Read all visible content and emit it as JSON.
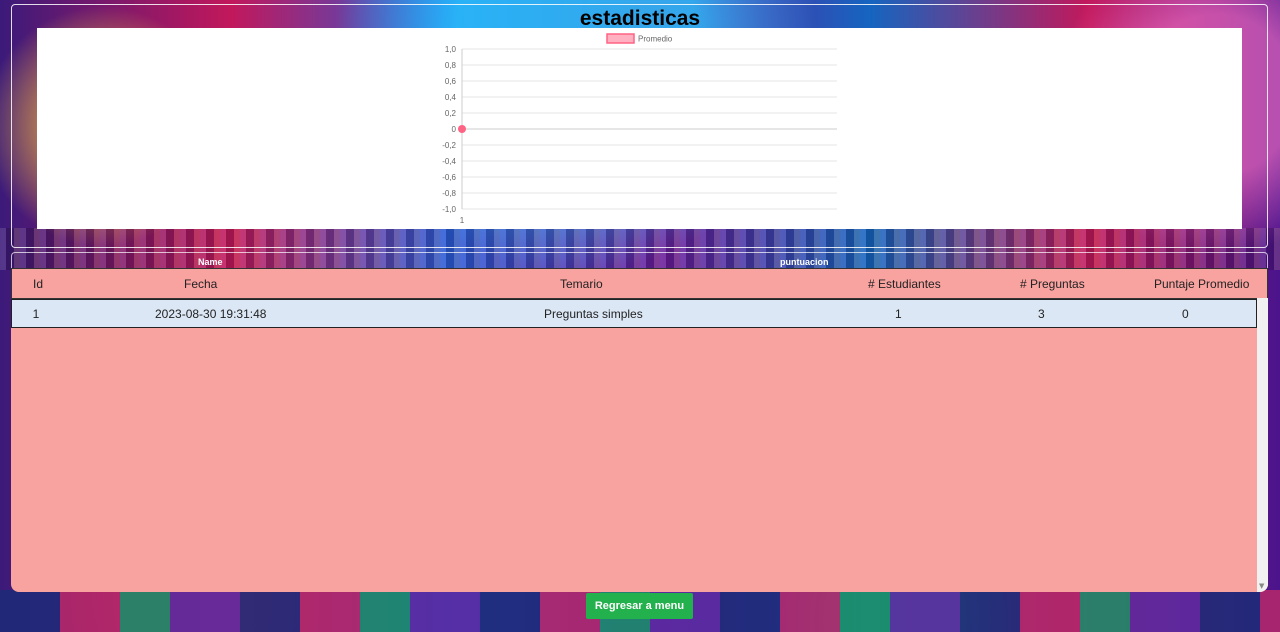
{
  "page": {
    "title": "estadisticas"
  },
  "chart_data": {
    "type": "line",
    "x": [
      "1"
    ],
    "series": [
      {
        "name": "Promedio",
        "values": [
          0
        ],
        "color": "#ff6384"
      }
    ],
    "ylim": [
      -1.0,
      1.0
    ],
    "yticks": [
      "1,0",
      "0,8",
      "0,6",
      "0,4",
      "0,2",
      "0",
      "-0,2",
      "-0,4",
      "-0,6",
      "-0,8",
      "-1,0"
    ],
    "legend": "top",
    "grid": true
  },
  "labels": {
    "name": "Name",
    "score": "puntuacion"
  },
  "table": {
    "headers": [
      "Id",
      "Fecha",
      "Temario",
      "# Estudiantes",
      "# Preguntas",
      "Puntaje Promedio"
    ],
    "rows": [
      [
        "1",
        "2023-08-30 19:31:48",
        "Preguntas simples",
        "1",
        "3",
        "0"
      ]
    ]
  },
  "buttons": {
    "back": "Regresar a menu"
  },
  "colors": {
    "table_bg": "#f9a3a0",
    "row_bg": "#dbe7f5",
    "button": "#22b14c"
  }
}
